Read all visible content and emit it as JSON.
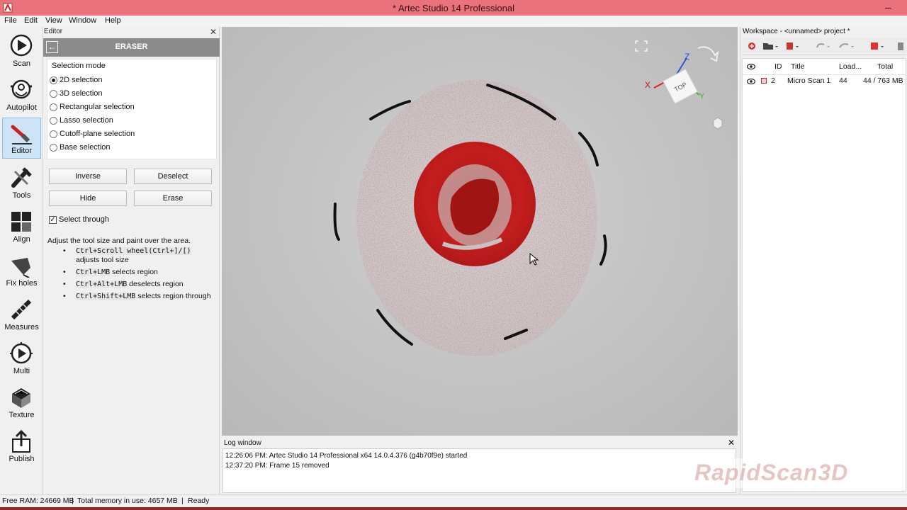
{
  "window": {
    "title": "* Artec Studio 14 Professional"
  },
  "menu": [
    "File",
    "Edit",
    "View",
    "Window",
    "Help"
  ],
  "toolbar": {
    "items": [
      {
        "label": "Scan",
        "icon": "scan-play-icon"
      },
      {
        "label": "Autopilot",
        "icon": "autopilot-icon"
      },
      {
        "label": "Editor",
        "icon": "editor-eraser-icon",
        "active": true
      },
      {
        "label": "Tools",
        "icon": "tools-icon"
      },
      {
        "label": "Align",
        "icon": "align-icon"
      },
      {
        "label": "Fix holes",
        "icon": "fix-holes-icon"
      },
      {
        "label": "Measures",
        "icon": "measures-icon"
      },
      {
        "label": "Multi",
        "icon": "multi-icon"
      },
      {
        "label": "Texture",
        "icon": "texture-icon"
      },
      {
        "label": "Publish",
        "icon": "publish-icon"
      }
    ]
  },
  "editor": {
    "header": "Editor",
    "close": "✕",
    "tool_name": "ERASER",
    "selection_mode_title": "Selection mode",
    "modes": [
      {
        "label": "2D selection",
        "selected": true
      },
      {
        "label": "3D selection",
        "selected": false
      },
      {
        "label": "Rectangular selection",
        "selected": false
      },
      {
        "label": "Lasso selection",
        "selected": false
      },
      {
        "label": "Cutoff-plane selection",
        "selected": false
      },
      {
        "label": "Base selection",
        "selected": false
      }
    ],
    "buttons": {
      "inverse": "Inverse",
      "deselect": "Deselect",
      "hide": "Hide",
      "erase": "Erase"
    },
    "select_through": {
      "label": "Select through",
      "checked": true
    },
    "hint": "Adjust the tool size and paint over the area.",
    "shortcuts": [
      {
        "keys": "Ctrl+Scroll wheel(Ctrl+]/[)",
        "text": "adjusts tool size"
      },
      {
        "keys": "Ctrl+LMB",
        "text": "selects region"
      },
      {
        "keys": "Ctrl+Alt+LMB",
        "text": "deselects region"
      },
      {
        "keys": "Ctrl+Shift+LMB",
        "text": "selects region through"
      }
    ]
  },
  "viewport": {
    "axes": {
      "x": "X",
      "y": "Y",
      "z": "Z",
      "cube_face": "TOP"
    },
    "colors": {
      "mesh_red": "#c41e1e",
      "cloud_red": "#9e4a52",
      "axis_x": "#e02020",
      "axis_y": "#38b838",
      "axis_z": "#2a52e0"
    }
  },
  "log": {
    "title": "Log window",
    "close": "✕",
    "lines": [
      "12:26:06 PM: Artec Studio 14 Professional x64 14.0.4.376 (g4b70f9e) started",
      "12:37:20 PM: Frame 15 removed"
    ]
  },
  "workspace": {
    "title": "Workspace - <unnamed> project *",
    "columns": [
      "ID",
      "Title",
      "Load...",
      "Total"
    ],
    "rows": [
      {
        "id": "2",
        "title": "Micro Scan 1",
        "loaded": "44",
        "total": "44 / 763 MB"
      }
    ]
  },
  "watermark": "RapidScan3D",
  "status": {
    "free_ram": "Free RAM: 24669 MB",
    "total_memory": "Total memory in use: 4657 MB",
    "state": "Ready"
  },
  "colors": {
    "titlebar": "#e9727c",
    "active_tool": "#cde4f7",
    "banner": "#8b8b8b"
  }
}
